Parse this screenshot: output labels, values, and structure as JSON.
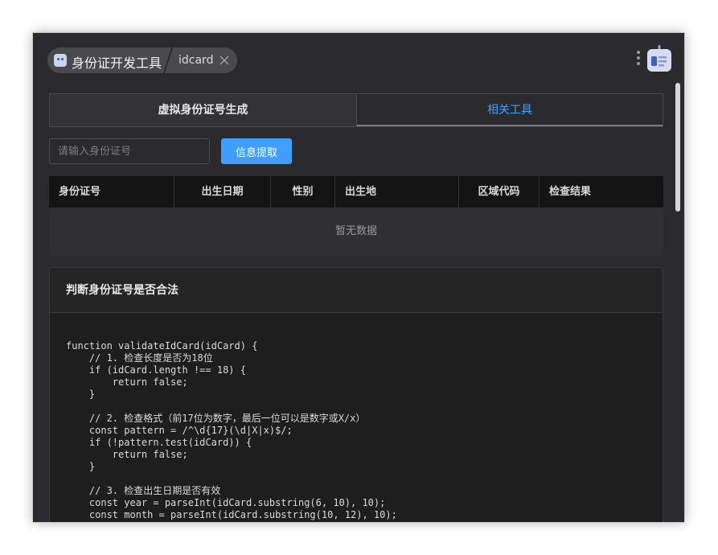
{
  "titlebar": {
    "app_name": "身份证开发工具",
    "sub_name": "idcard"
  },
  "tabs": [
    {
      "label": "虚拟身份证号生成"
    },
    {
      "label": "相关工具"
    }
  ],
  "search": {
    "placeholder": "请输入身份证号",
    "button_label": "信息提取"
  },
  "table": {
    "headers": [
      "身份证号",
      "出生日期",
      "性别",
      "出生地",
      "区域代码",
      "检查结果"
    ],
    "empty_text": "暂无数据"
  },
  "card": {
    "title": "判断身份证号是否合法",
    "code": "function validateIdCard(idCard) {\n    // 1. 检查长度是否为18位\n    if (idCard.length !== 18) {\n        return false;\n    }\n\n    // 2. 检查格式（前17位为数字，最后一位可以是数字或X/x）\n    const pattern = /^\\d{17}(\\d|X|x)$/;\n    if (!pattern.test(idCard)) {\n        return false;\n    }\n\n    // 3. 检查出生日期是否有效\n    const year = parseInt(idCard.substring(6, 10), 10);\n    const month = parseInt(idCard.substring(10, 12), 10);"
  },
  "colors": {
    "accent": "#409eff",
    "background": "#2b2b2d",
    "table_header": "#141414"
  },
  "icons": {
    "app": "robot-icon",
    "close": "close-icon",
    "more": "more-vertical-icon",
    "assistant": "robot-icon"
  }
}
